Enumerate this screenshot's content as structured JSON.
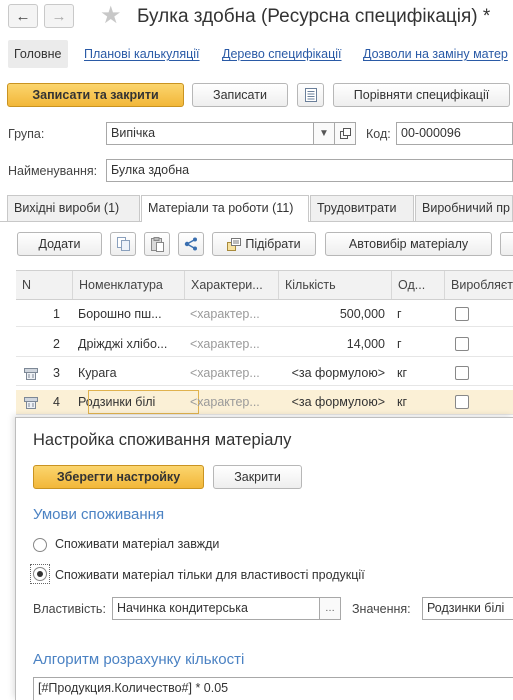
{
  "window": {
    "title": "Булка здобна (Ресурсна специфікація) *",
    "back_icon": "←",
    "forward_icon": "→",
    "favorite_icon": "★"
  },
  "menu": {
    "items": [
      {
        "label": "Головне"
      },
      {
        "label": "Планові калькуляції"
      },
      {
        "label": "Дерево специфікації"
      },
      {
        "label": "Дозволи на заміну матер"
      }
    ]
  },
  "toolbar": {
    "save_close_label": "Записати та закрити",
    "save_label": "Записати",
    "compare_label": "Порівняти специфікації"
  },
  "form": {
    "group_label": "Група:",
    "group_value": "Випічка",
    "code_label": "Код:",
    "code_value": "00-000096",
    "name_label": "Найменування:",
    "name_value": "Булка здобна"
  },
  "tabs": [
    {
      "label": "Вихідні вироби (1)"
    },
    {
      "label": "Матеріали та роботи (11)"
    },
    {
      "label": "Трудовитрати"
    },
    {
      "label": "Виробничий пр"
    }
  ],
  "grid_toolbar": {
    "add_label": "Додати",
    "pick_label": "Підібрати",
    "auto_label": "Автовибір матеріалу"
  },
  "grid": {
    "columns": [
      "N",
      "Номенклатура",
      "Характери...",
      "Кількість",
      "Од...",
      "Виробляєт"
    ],
    "rows": [
      {
        "n": "1",
        "name": "Борошно пш...",
        "char": "<характер...",
        "qty": "500,000",
        "unit": "г",
        "formula": false
      },
      {
        "n": "2",
        "name": "Дріжджі хлібо...",
        "char": "<характер...",
        "qty": "14,000",
        "unit": "г",
        "formula": false
      },
      {
        "n": "3",
        "name": "Курага",
        "char": "<характер...",
        "qty": "<за формулою>",
        "unit": "кг",
        "formula": true
      },
      {
        "n": "4",
        "name": "Родзинки білі",
        "char": "<характер...",
        "qty": "<за формулою>",
        "unit": "кг",
        "formula": true
      }
    ]
  },
  "popup": {
    "title": "Настройка споживання матеріалу",
    "save_label": "Зберегти настройку",
    "close_label": "Закрити",
    "conditions_title": "Умови споживання",
    "option_always": "Споживати матеріал завжди",
    "option_property": "Споживати матеріал тільки для властивості продукції",
    "selected_option": "property",
    "property_label": "Властивість:",
    "property_value": "Начинка кондитерська",
    "value_label": "Значення:",
    "value_value": "Родзинки білі",
    "algorithm_title": "Алгоритм розрахунку кількості",
    "formula": "[#Продукция.Количество#] * 0.05"
  }
}
